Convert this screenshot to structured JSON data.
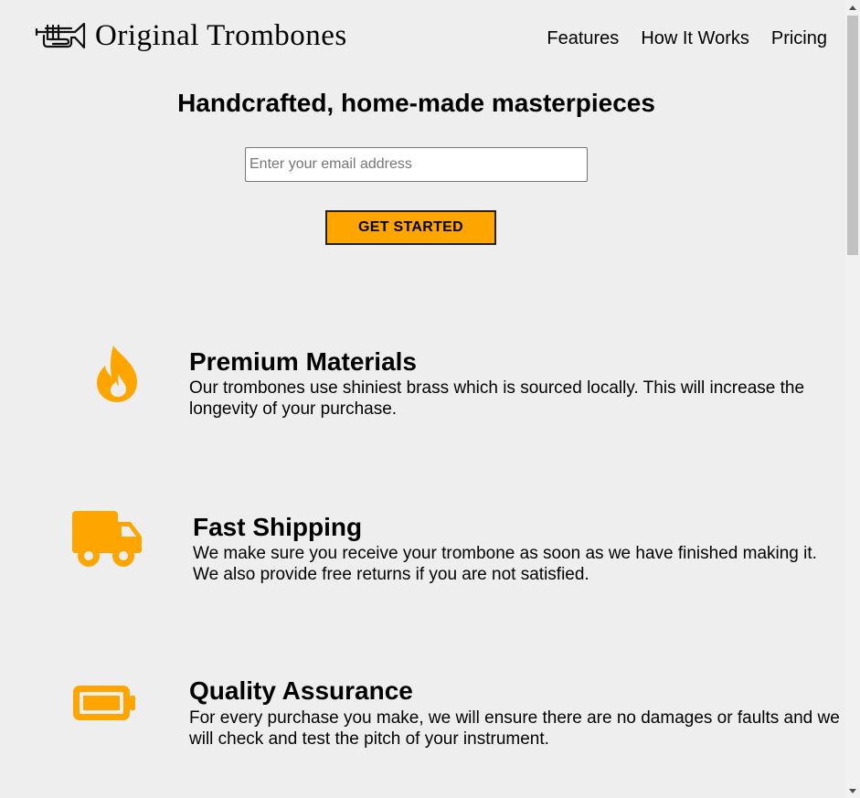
{
  "header": {
    "brand": "Original Trombones",
    "nav": [
      "Features",
      "How It Works",
      "Pricing"
    ]
  },
  "hero": {
    "title": "Handcrafted, home-made masterpieces",
    "email_placeholder": "Enter your email address",
    "cta_label": "GET STARTED"
  },
  "features": [
    {
      "icon": "flame-icon",
      "title": "Premium Materials",
      "description": "Our trombones use shiniest brass which is sourced locally. This will increase the longevity of your purchase."
    },
    {
      "icon": "truck-icon",
      "title": "Fast Shipping",
      "description": "We make sure you receive your trombone as soon as we have finished making it. We also provide free returns if you are not satisfied."
    },
    {
      "icon": "battery-icon",
      "title": "Quality Assurance",
      "description": "For every purchase you make, we will ensure there are no damages or faults and we will check and test the pitch of your instrument."
    }
  ],
  "colors": {
    "accent": "#ffa500",
    "background": "#eeeeee"
  }
}
